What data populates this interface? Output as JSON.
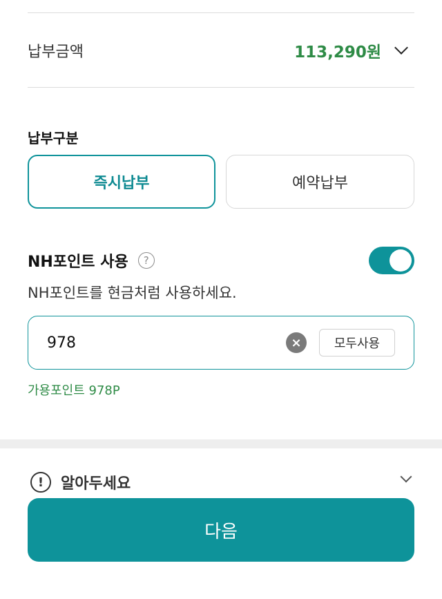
{
  "payment_amount": {
    "label": "납부금액",
    "value": "113,290원",
    "icon": "chevron-down-icon"
  },
  "payment_type": {
    "label": "납부구분",
    "options": [
      {
        "label": "즉시납부",
        "selected": true
      },
      {
        "label": "예약납부",
        "selected": false
      }
    ]
  },
  "nh_points": {
    "title": "NH포인트 사용",
    "help_icon": "?",
    "toggle_on": true,
    "description": "NH포인트를 현금처럼 사용하세요.",
    "input_value": "978",
    "clear_icon": "×",
    "use_all_label": "모두사용",
    "available_text": "가용포인트 978P"
  },
  "notice": {
    "icon": "!",
    "label": "알아두세요"
  },
  "next_button": {
    "label": "다음"
  },
  "colors": {
    "accent": "#0e939a",
    "amount_green": "#2e8b46"
  }
}
